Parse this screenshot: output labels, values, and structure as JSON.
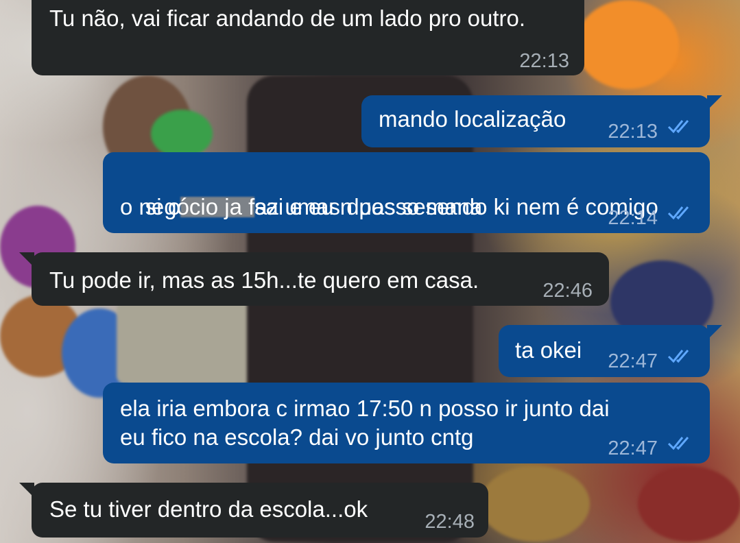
{
  "messages": [
    {
      "direction": "incoming",
      "text": "Tu não, vai ficar andando de um lado pro outro.",
      "time": "22:13"
    },
    {
      "direction": "outgoing",
      "text": "mando localização",
      "time": "22:13",
      "status": "read-double-check-icon"
    },
    {
      "direction": "outgoing",
      "text_part1": "si o",
      "text_part2": "sai e eu n posso sendo ki nem é comigo",
      "text_line2": "o negócio ja faz umas duas semana",
      "time": "22:14",
      "status": "read-double-check-icon"
    },
    {
      "direction": "incoming",
      "text": "Tu pode ir, mas as 15h...te quero em casa.",
      "time": "22:46"
    },
    {
      "direction": "outgoing",
      "text": "ta okei",
      "time": "22:47",
      "status": "read-double-check-icon"
    },
    {
      "direction": "outgoing",
      "text_line1": "ela iria embora c irmao 17:50 n posso ir junto dai",
      "text_line2": "eu fico na escola? dai vo junto cntg",
      "time": "22:47",
      "status": "read-double-check-icon"
    },
    {
      "direction": "incoming",
      "text": "Se tu tiver dentro da escola...ok",
      "time": "22:48"
    }
  ],
  "colors": {
    "incoming_bubble": "#232627",
    "outgoing_bubble": "#0a4a8f",
    "read_ticks": "#5fa8ff"
  }
}
